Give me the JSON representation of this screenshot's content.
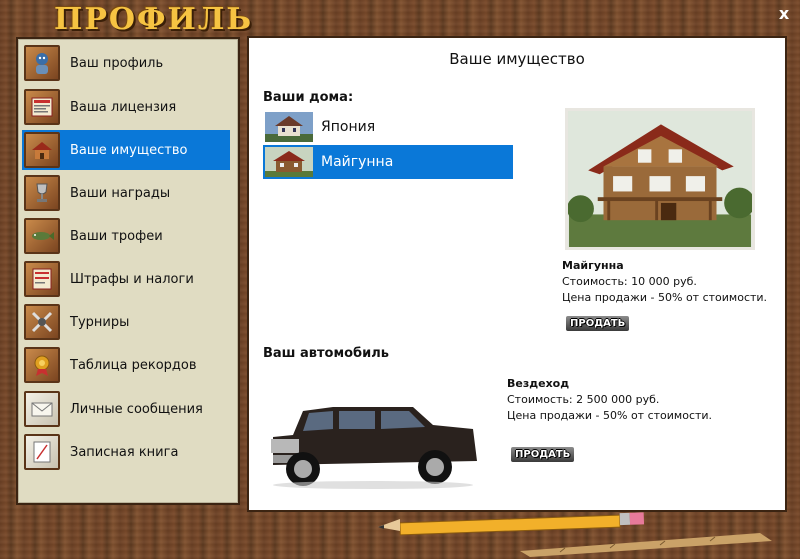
{
  "window": {
    "title": "ПРОФИЛЬ",
    "close_label": "x"
  },
  "sidebar": {
    "items": [
      {
        "label": "Ваш профиль",
        "icon": "profile-icon"
      },
      {
        "label": "Ваша лицензия",
        "icon": "license-icon"
      },
      {
        "label": "Ваше имущество",
        "icon": "property-icon",
        "active": true
      },
      {
        "label": "Ваши награды",
        "icon": "award-icon"
      },
      {
        "label": "Ваши трофеи",
        "icon": "trophy-fish-icon"
      },
      {
        "label": "Штрафы и налоги",
        "icon": "fine-icon"
      },
      {
        "label": "Турниры",
        "icon": "tournament-icon"
      },
      {
        "label": "Таблица рекордов",
        "icon": "records-icon"
      },
      {
        "label": "Личные сообщения",
        "icon": "envelope-icon"
      },
      {
        "label": "Записная книга",
        "icon": "notebook-icon"
      }
    ]
  },
  "content": {
    "title": "Ваше имущество",
    "houses": {
      "label": "Ваши дома:",
      "items": [
        {
          "name": "Япония"
        },
        {
          "name": "Майгунна",
          "selected": true
        }
      ],
      "selected_info": {
        "name": "Майгунна",
        "cost": "Стоимость: 10 000 руб.",
        "sale": "Цена продажи - 50% от стоимости.",
        "sell_label": "ПРОДАТЬ"
      }
    },
    "car": {
      "label": "Ваш автомобиль",
      "name": "Вездеход",
      "cost": "Стоимость: 2 500 000 руб.",
      "sale": "Цена продажи - 50% от стоимости.",
      "sell_label": "ПРОДАТЬ"
    }
  },
  "colors": {
    "accent": "#0a78d8",
    "title_gold": "#f6c342",
    "wood": "#6b4024",
    "sidebar_bg": "#e0dcc2"
  }
}
